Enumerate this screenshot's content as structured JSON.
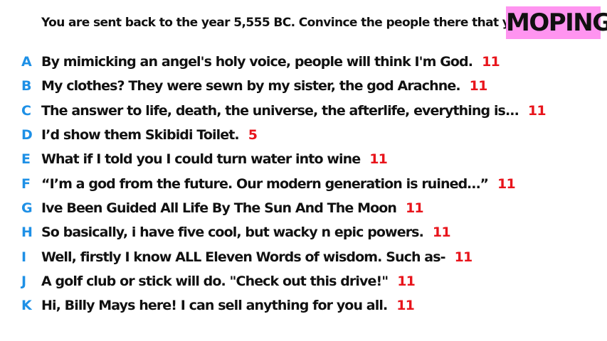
{
  "prompt": "You are sent back to the year 5,555 BC. Convince the people there that you're a god.",
  "badge": {
    "label": "MOPING",
    "color": "#ff94f0"
  },
  "colors": {
    "letter": "#1e90e6",
    "score": "#e8141b",
    "text": "#111111"
  },
  "options": [
    {
      "letter": "A",
      "text": "By mimicking an angel's holy voice, people will think I'm God.",
      "score": "11"
    },
    {
      "letter": "B",
      "text": "My clothes? They were sewn by my sister, the god Arachne.",
      "score": "11"
    },
    {
      "letter": "C",
      "text": "The answer to life, death, the universe, the afterlife, everything is...",
      "score": "11"
    },
    {
      "letter": "D",
      "text": "I’d show them Skibidi Toilet.",
      "score": "5"
    },
    {
      "letter": "E",
      "text": "What if I told you I could turn water into wine",
      "score": "11"
    },
    {
      "letter": "F",
      "text": "“I’m a god from the future. Our modern generation is ruined…”",
      "score": "11"
    },
    {
      "letter": "G",
      "text": "Ive Been Guided All Life By The Sun And The Moon",
      "score": "11"
    },
    {
      "letter": "H",
      "text": "So basically, i have five cool, but wacky n epic powers.",
      "score": "11"
    },
    {
      "letter": "I",
      "text": "Well, firstly I know ALL Eleven Words of wisdom. Such as-",
      "score": "11"
    },
    {
      "letter": "J",
      "text": "A golf club or stick will do. \"Check out this drive!\"",
      "score": "11"
    },
    {
      "letter": "K",
      "text": "Hi, Billy Mays here! I can sell anything for you all.",
      "score": "11"
    }
  ]
}
